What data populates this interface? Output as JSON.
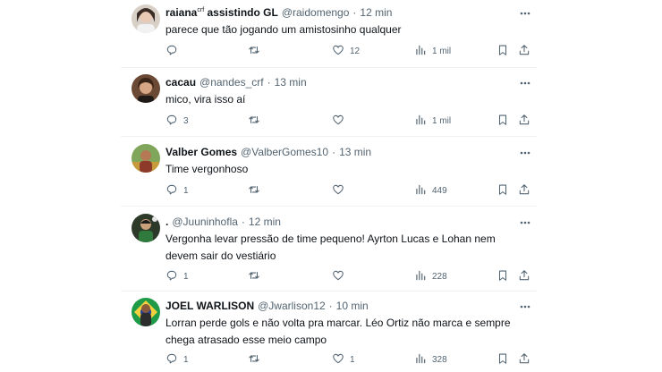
{
  "colors": {
    "text": "#0f1419",
    "secondary": "#536471",
    "divider": "#eff3f4"
  },
  "icons": [
    "reply-icon",
    "retweet-icon",
    "like-icon",
    "views-icon",
    "bookmark-icon",
    "share-icon",
    "more-icon"
  ],
  "tweets": [
    {
      "name": "raiana",
      "name_badge": "crf",
      "name_suffix": " assistindo GL",
      "handle": "@raidomengo",
      "sep": "·",
      "time": "12 min",
      "text": "parece que tão jogando um amistosinho qualquer",
      "replies": "",
      "retweets": "",
      "likes": "12",
      "views": "1 mil"
    },
    {
      "name": "cacau",
      "name_badge": "",
      "name_suffix": "",
      "handle": "@nandes_crf",
      "sep": "·",
      "time": "13 min",
      "text": "mico, vira isso aí",
      "replies": "3",
      "retweets": "",
      "likes": "",
      "views": "1 mil"
    },
    {
      "name": "Valber Gomes",
      "name_badge": "",
      "name_suffix": "",
      "handle": "@ValberGomes10",
      "sep": "·",
      "time": "13 min",
      "text": "Time vergonhoso",
      "replies": "1",
      "retweets": "",
      "likes": "",
      "views": "449"
    },
    {
      "name": ".",
      "name_badge": "",
      "name_suffix": "",
      "handle": "@Juuninhofla",
      "sep": "·",
      "time": "12 min",
      "text": "Vergonha levar pressão de time pequeno! Ayrton Lucas e Lohan nem devem sair do vestiário",
      "replies": "1",
      "retweets": "",
      "likes": "",
      "views": "228"
    },
    {
      "name": "JOEL WARLISON",
      "name_badge": "",
      "name_suffix": "",
      "handle": "@Jwarlison12",
      "sep": "·",
      "time": "10 min",
      "text": "Lorran perde gols e não volta pra marcar. Léo Ortiz não marca e sempre chega atrasado esse meio campo",
      "replies": "1",
      "retweets": "",
      "likes": "1",
      "views": "328"
    }
  ]
}
